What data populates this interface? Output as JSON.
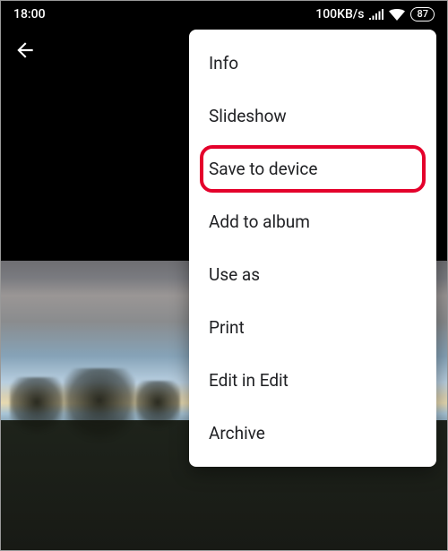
{
  "status": {
    "time": "18:00",
    "data_rate": "100KB/s",
    "battery": "87"
  },
  "menu": {
    "items": [
      {
        "label": "Info"
      },
      {
        "label": "Slideshow"
      },
      {
        "label": "Save to device",
        "highlighted": true
      },
      {
        "label": "Add to album"
      },
      {
        "label": "Use as"
      },
      {
        "label": "Print"
      },
      {
        "label": "Edit in Edit"
      },
      {
        "label": "Archive"
      }
    ]
  }
}
